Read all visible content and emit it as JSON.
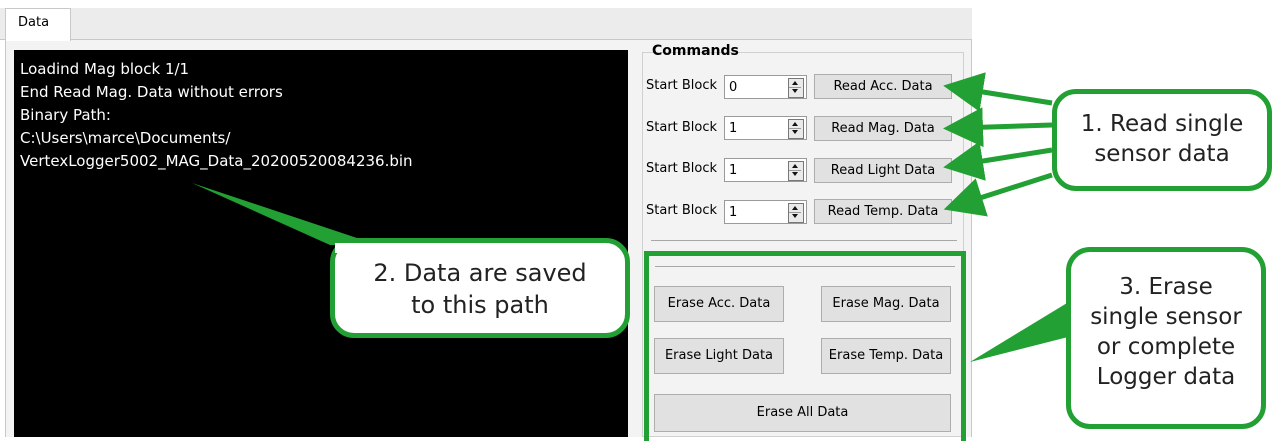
{
  "tab": {
    "label": "Data"
  },
  "console": {
    "lines": [
      "Loadind Mag block 1/1",
      "End Read Mag. Data without errors",
      "Binary Path:",
      "C:\\Users\\marce\\Documents/",
      "VertexLogger5002_MAG_Data_20200520084236.bin"
    ]
  },
  "commands": {
    "title": "Commands",
    "rows": [
      {
        "label": "Start Block",
        "value": "0",
        "button": "Read Acc. Data"
      },
      {
        "label": "Start Block",
        "value": "1",
        "button": "Read Mag. Data"
      },
      {
        "label": "Start Block",
        "value": "1",
        "button": "Read Light Data"
      },
      {
        "label": "Start Block",
        "value": "1",
        "button": "Read Temp. Data"
      }
    ],
    "erase": {
      "acc": "Erase Acc. Data",
      "mag": "Erase Mag. Data",
      "light": "Erase Light Data",
      "temp": "Erase Temp. Data",
      "all": "Erase All Data"
    }
  },
  "annotations": {
    "callout1": [
      "1. Read single",
      "sensor data"
    ],
    "callout2": [
      "2. Data are saved",
      "to this path"
    ],
    "callout3": [
      "3. Erase",
      "single sensor",
      "or complete",
      "Logger data"
    ],
    "color": "#22a033"
  }
}
